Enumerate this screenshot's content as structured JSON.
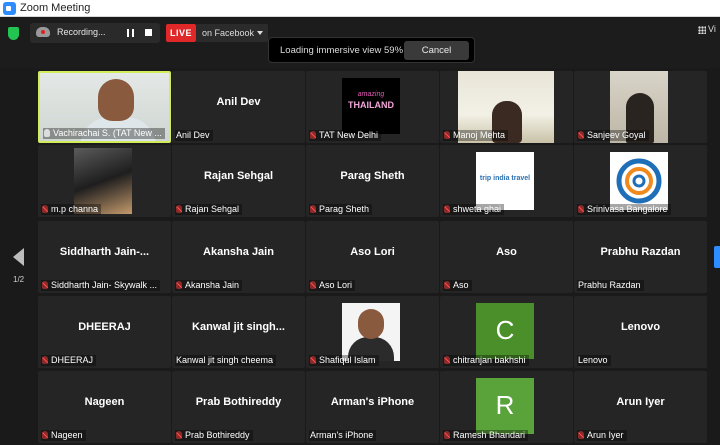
{
  "window": {
    "title": "Zoom Meeting"
  },
  "toolbar": {
    "recording_label": "Recording...",
    "live_label": "LIVE",
    "live_destination": "on Facebook",
    "loading_text": "Loading immersive view 59%",
    "cancel_label": "Cancel",
    "view_label": "Vi"
  },
  "pagination": {
    "page": "1/2"
  },
  "tiles": [
    {
      "display": "",
      "label": "Vachirachai S. (TAT New ...",
      "muted": false,
      "picture": "video-feed"
    },
    {
      "display": "Anil Dev",
      "label": "Anil Dev",
      "muted": false
    },
    {
      "display": "",
      "label": "TAT New Delhi",
      "muted": true,
      "picture": "amazing-thailand-logo",
      "logo_text_top": "amazing",
      "logo_text": "THAILAND"
    },
    {
      "display": "",
      "label": "Manoj Mehta",
      "muted": true,
      "picture": "video-feed"
    },
    {
      "display": "",
      "label": "Sanjeev Goyal",
      "muted": true,
      "picture": "video-feed"
    },
    {
      "display": "",
      "label": "m.p channa",
      "muted": true,
      "picture": "profile-photo"
    },
    {
      "display": "Rajan Sehgal",
      "label": "Rajan Sehgal",
      "muted": true
    },
    {
      "display": "Parag Sheth",
      "label": "Parag Sheth",
      "muted": true
    },
    {
      "display": "",
      "label": "shweta ghai",
      "muted": true,
      "picture": "trip-india-travel-logo",
      "logo_text": "trip india travel"
    },
    {
      "display": "",
      "label": "Srinivasa Bangalore",
      "muted": true,
      "picture": "circle-logo"
    },
    {
      "display": "Siddharth  Jain-...",
      "label": "Siddharth Jain- Skywalk ...",
      "muted": true
    },
    {
      "display": "Akansha Jain",
      "label": "Akansha Jain",
      "muted": true
    },
    {
      "display": "Aso Lori",
      "label": "Aso Lori",
      "muted": true
    },
    {
      "display": "Aso",
      "label": "Aso",
      "muted": true
    },
    {
      "display": "Prabhu Razdan",
      "label": "Prabhu Razdan",
      "muted": false
    },
    {
      "display": "DHEERAJ",
      "label": "DHEERAJ",
      "muted": true
    },
    {
      "display": "Kanwal jit singh...",
      "label": "Kanwal jit singh cheema",
      "muted": false
    },
    {
      "display": "",
      "label": "Shafiqul Islam",
      "muted": true,
      "picture": "profile-photo"
    },
    {
      "display": "",
      "label": "chitranjan bakhshi",
      "muted": true,
      "picture": "letter-avatar",
      "letter": "C",
      "color": "#4a8f2a"
    },
    {
      "display": "Lenovo",
      "label": "Lenovo",
      "muted": false
    },
    {
      "display": "Nageen",
      "label": "Nageen",
      "muted": true
    },
    {
      "display": "Prab Bothireddy",
      "label": "Prab Bothireddy",
      "muted": true
    },
    {
      "display": "Arman's iPhone",
      "label": "Arman's iPhone",
      "muted": false
    },
    {
      "display": "",
      "label": "Ramesh Bhandari",
      "muted": true,
      "picture": "letter-avatar",
      "letter": "R",
      "color": "#5aa23a"
    },
    {
      "display": "Arun Iyer",
      "label": "Arun Iyer",
      "muted": true
    }
  ]
}
